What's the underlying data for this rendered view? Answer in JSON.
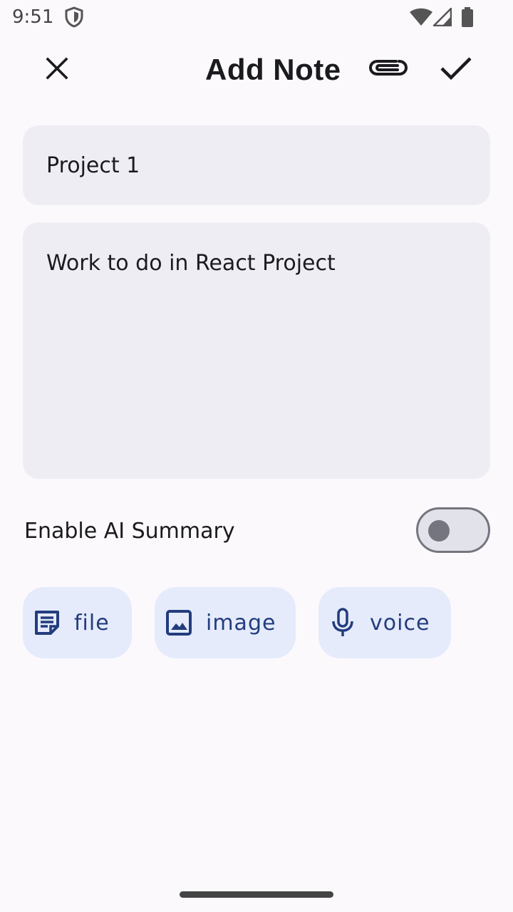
{
  "status_bar": {
    "time": "9:51",
    "icons": [
      "shield-icon",
      "wifi-icon",
      "signal-icon",
      "battery-icon"
    ]
  },
  "toolbar": {
    "title": "Add Note",
    "close_icon": "close-icon",
    "attach_icon": "paperclip-icon",
    "save_icon": "check-icon"
  },
  "note": {
    "title_value": "Project 1",
    "body_value": "Work to do in React Project"
  },
  "ai_summary": {
    "label": "Enable AI Summary",
    "enabled": false
  },
  "attachments": [
    {
      "label": "file",
      "icon": "note-icon"
    },
    {
      "label": "image",
      "icon": "image-icon"
    },
    {
      "label": "voice",
      "icon": "microphone-icon"
    }
  ],
  "colors": {
    "background": "#fcf9fd",
    "field_background": "#eeedf3",
    "chip_background": "#e5ebfb",
    "chip_accent": "#233c7d",
    "toggle_outline": "#74757e"
  }
}
